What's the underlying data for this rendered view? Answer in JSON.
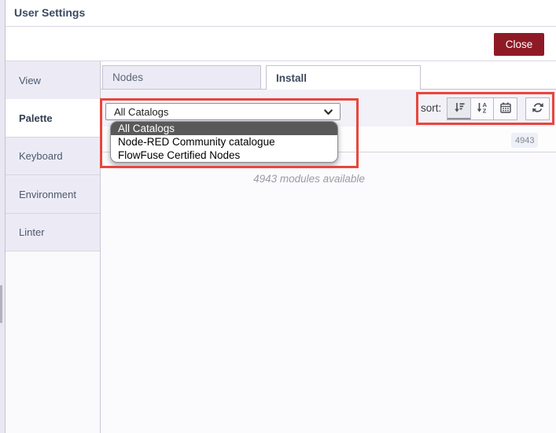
{
  "window": {
    "title": "User Settings",
    "close_label": "Close"
  },
  "sidebar": {
    "selected": "Palette",
    "items": [
      {
        "label": "View"
      },
      {
        "label": "Palette"
      },
      {
        "label": "Keyboard"
      },
      {
        "label": "Environment"
      },
      {
        "label": "Linter"
      }
    ]
  },
  "main": {
    "tabs": [
      {
        "label": "Nodes"
      },
      {
        "label": "Install"
      }
    ],
    "active_tab": "Install",
    "toolbar": {
      "catalog_select": {
        "value": "All Catalogs",
        "options": [
          "All Catalogs",
          "Node-RED Community catalogue",
          "FlowFuse Certified Nodes"
        ],
        "highlighted_option": "All Catalogs"
      },
      "sort_label": "sort:"
    },
    "search": {
      "count_badge": "4943"
    },
    "list": {
      "status_text": "4943 modules available"
    }
  },
  "icons": {
    "chevron_down": "chevron-down-icon",
    "sort_amount": "sort-amount-icon",
    "sort_alpha": "sort-alpha-icon",
    "sort_date": "calendar-icon",
    "refresh": "refresh-icon"
  },
  "colors": {
    "close_button": "#8e1a26",
    "annotation_red": "#e8463b",
    "option_highlight": "#595959",
    "tab_inactive_bg": "#ecebf5",
    "toolbar_bg": "#f2f1f8"
  }
}
